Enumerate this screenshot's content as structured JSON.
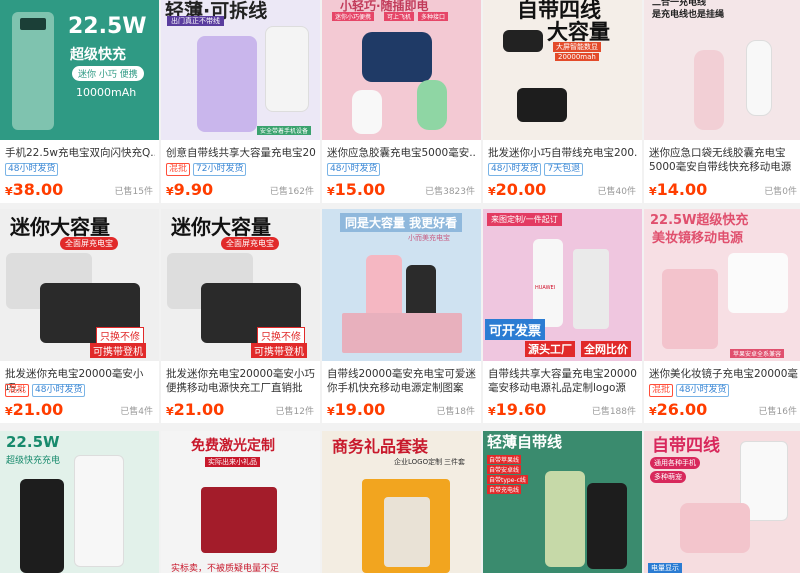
{
  "products": [
    {
      "title": "手机22.5w充电宝双向闪快充Q...",
      "tags": [
        {
          "text": "48小时发货",
          "type": "blue"
        }
      ],
      "price": "38.00",
      "sold": "已售15件",
      "image_text": [
        "22.5W",
        "超级快充",
        "迷你 小巧 便携",
        "10000mAh"
      ]
    },
    {
      "title": "创意自带线共享大容量充电宝20...",
      "tags": [
        {
          "text": "混批",
          "type": "red"
        },
        {
          "text": "72小时发货",
          "type": "blue"
        }
      ],
      "price": "9.90",
      "sold": "已售162件",
      "image_text": [
        "轻薄·可拆线",
        "出门真正不带线",
        "安全带着手机设备"
      ]
    },
    {
      "title": "迷你应急胶囊充电宝5000毫安...",
      "tags": [
        {
          "text": "48小时发货",
          "type": "blue"
        }
      ],
      "price": "15.00",
      "sold": "已售3823件",
      "image_text": [
        "小轻巧·随插即电",
        "迷你小巧便携",
        "可上飞机",
        "多种接口"
      ]
    },
    {
      "title": "批发迷你小巧自带线充电宝200...",
      "tags": [
        {
          "text": "48小时发货",
          "type": "blue"
        },
        {
          "text": "7天包退",
          "type": "blue"
        }
      ],
      "price": "20.00",
      "sold": "已售40件",
      "image_text": [
        "自带四线",
        "大容量",
        "大屏智能数显",
        "20000mah"
      ]
    },
    {
      "title": "迷你应急口袋无线胶囊充电宝5000毫安自带线快充移动电源批发",
      "tags": [],
      "price": "14.00",
      "sold": "已售0件",
      "image_text": [
        "二合一充电线",
        "是充电线也是挂绳"
      ]
    },
    {
      "title": "批发迷你充电宝20000毫安小巧...",
      "tags": [
        {
          "text": "混批",
          "type": "red"
        },
        {
          "text": "48小时发货",
          "type": "blue"
        }
      ],
      "price": "21.00",
      "sold": "已售4件",
      "image_text": [
        "迷你大容量",
        "全面屏充电宝",
        "只换不修",
        "可携带登机"
      ]
    },
    {
      "title": "批发迷你充电宝20000毫安小巧便携移动电源快充工厂直销批发...",
      "tags": [],
      "price": "21.00",
      "sold": "已售12件",
      "image_text": [
        "迷你大容量",
        "全面屏充电宝",
        "只换不修",
        "可携带登机"
      ]
    },
    {
      "title": "自带线20000毫安充电宝可爱迷你手机快充移动电源定制图案logo",
      "tags": [],
      "price": "19.00",
      "sold": "已售18件",
      "image_text": [
        "同是大容量 我更好看",
        "小而美充电宝"
      ]
    },
    {
      "title": "自带线共享大容量充电宝20000毫安移动电源礼品定制logo源头...",
      "tags": [],
      "price": "19.60",
      "sold": "已售188件",
      "image_text": [
        "来图定制/一件起订",
        "可开发票",
        "源头工厂",
        "全网比价",
        "HUAWEI"
      ]
    },
    {
      "title": "迷你美化妆镜子充电宝20000毫...",
      "tags": [
        {
          "text": "混批",
          "type": "red"
        },
        {
          "text": "48小时发货",
          "type": "blue"
        }
      ],
      "price": "26.00",
      "sold": "已售16件",
      "image_text": [
        "22.5W超级快充",
        "美妆镜移动电源",
        "苹果安卓全系兼容"
      ]
    },
    {
      "title": "",
      "tags": [],
      "price": "",
      "sold": "",
      "image_text": [
        "22.5W",
        "超级快充充电"
      ]
    },
    {
      "title": "",
      "tags": [],
      "price": "",
      "sold": "",
      "image_text": [
        "免费激光定制",
        "实际出来小礼品",
        "实标卖，不被质疑电量不足"
      ]
    },
    {
      "title": "",
      "tags": [],
      "price": "",
      "sold": "",
      "image_text": [
        "商务礼品套装",
        "企业LOGO定制",
        "三件套"
      ]
    },
    {
      "title": "",
      "tags": [],
      "price": "",
      "sold": "",
      "image_text": [
        "轻薄自带线",
        "自带苹果线",
        "自带安卓线",
        "自带type-c线",
        "自带充电线"
      ]
    },
    {
      "title": "",
      "tags": [],
      "price": "",
      "sold": "",
      "image_text": [
        "自带四线",
        "通用各种手机",
        "多种萌宠",
        "电量显示"
      ]
    }
  ],
  "currency": "¥",
  "colors": {
    "price": "#ff3d00",
    "tag_blue": "#3b87d4",
    "tag_red": "#ff4e3a"
  }
}
